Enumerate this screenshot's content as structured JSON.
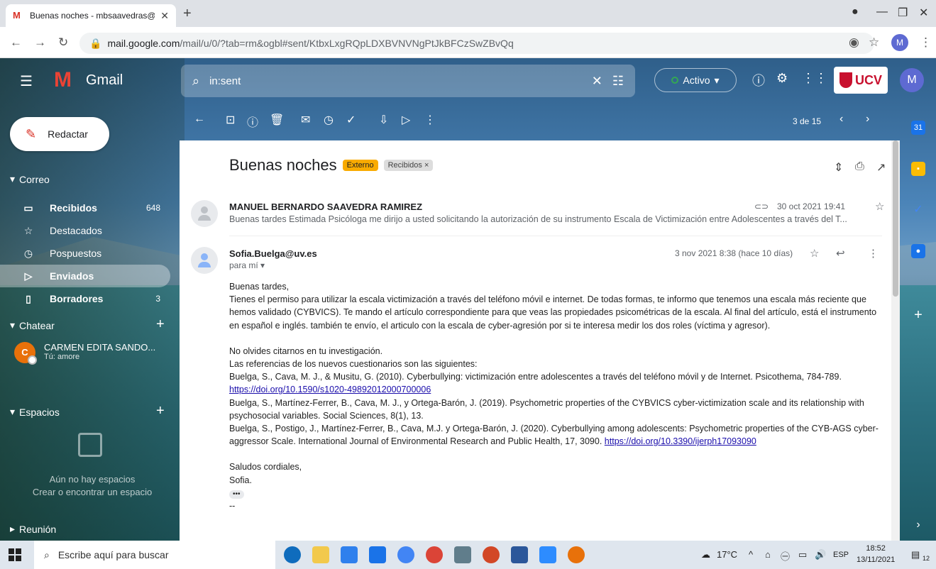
{
  "browser": {
    "tab_title": "Buenas noches - mbsaavedras@u",
    "url_host": "mail.google.com",
    "url_path": "/mail/u/0/?tab=rm&ogbl#sent/KtbxLxgRQpLDXBVNVNgPtJkBFCzSwZBvQq",
    "profile_initial": "M"
  },
  "gmail": {
    "brand": "Gmail",
    "search_query": "in:sent",
    "status": "Activo",
    "org_logo": "UCV",
    "avatar_initial": "M",
    "compose_label": "Redactar",
    "sections": {
      "mail": "Correo",
      "chat": "Chatear",
      "spaces": "Espacios",
      "meet": "Reunión"
    },
    "folders": [
      {
        "label": "Recibidos",
        "count": "648",
        "icon": "inbox-icon"
      },
      {
        "label": "Destacados",
        "count": "",
        "icon": "star-icon"
      },
      {
        "label": "Pospuestos",
        "count": "",
        "icon": "clock-icon"
      },
      {
        "label": "Enviados",
        "count": "",
        "icon": "send-icon"
      },
      {
        "label": "Borradores",
        "count": "3",
        "icon": "draft-icon"
      }
    ],
    "chat_user": {
      "initial": "C",
      "name": "CARMEN EDITA SANDO...",
      "sub": "Tú: amore"
    },
    "spaces_empty": "Aún no hay espacios",
    "spaces_link": "Crear o encontrar un espacio",
    "pager": "3 de 15"
  },
  "thread": {
    "subject": "Buenas noches",
    "badge_external": "Externo",
    "badge_label": "Recibidos ×",
    "messages": [
      {
        "sender": "MANUEL BERNARDO SAAVEDRA RAMIREZ",
        "date": "30 oct 2021 19:41",
        "snippet": "Buenas tardes Estimada Psicóloga me dirijo a usted solicitando la autorización de su instrumento Escala de Victimización entre Adolescentes a través del T..."
      },
      {
        "sender": "Sofia.Buelga@uv.es",
        "date": "3 nov 2021 8:38 (hace 10 días)",
        "to": "para mí",
        "greeting": "Buenas tardes,",
        "p1": "Tienes el permiso para utilizar  la escala victimización a través del teléfono móvil e internet. De todas formas, te informo que tenemos una escala más reciente que hemos validado (CYBVICS). Te mando el artículo correspondiente para que veas las propiedades psicométricas de la escala. Al final del artículo, está el instrumento en español e inglés. también te envío, el articulo con la escala de cyber-agresión por si te interesa medir los dos roles (víctima y agresor).",
        "l1": "No olvides citarnos en tu investigación.",
        "l2": "Las referencias de los nuevos cuestionarios son las siguientes:",
        "ref1": "Buelga, S., Cava, M. J., & Musitu, G. (2010). Cyberbullying: victimización entre adolescentes a través del teléfono móvil y de Internet. Psicothema, 784-789.",
        "ref1_link": "https://doi.org/10.1590/s1020-49892012000700006",
        "ref2": "Buelga, S., Martínez-Ferrer, B., Cava, M. J., y Ortega-Barón, J. (2019). Psychometric properties of the CYBVICS cyber-victimization scale and its relationship with psychosocial variables. Social Sciences, 8(1), 13.",
        "ref3": "Buelga, S., Postigo, J., Martínez-Ferrer, B., Cava, M.J. y Ortega-Barón, J. (2020). Cyberbullying among adolescents: Psychometric properties of the CYB-AGS cyber-aggressor Scale. International Journal of Environmental Research and Public Health, 17, 3090.",
        "ref3_link": "https://doi.org/10.3390/ijerph17093090",
        "closing": "Saludos cordiales,",
        "signature": "Sofia.",
        "trimmed": "•••",
        "dash": "--"
      }
    ]
  },
  "taskbar": {
    "search_placeholder": "Escribe aquí para buscar",
    "weather": "17°C",
    "lang": "ESP",
    "time": "18:52",
    "date": "13/11/2021",
    "notif_count": "12"
  },
  "colors": {
    "gmail_red": "#ea4335",
    "badge_external": "#f9ab00",
    "link": "#1a0dab",
    "status_green": "#34a853"
  }
}
